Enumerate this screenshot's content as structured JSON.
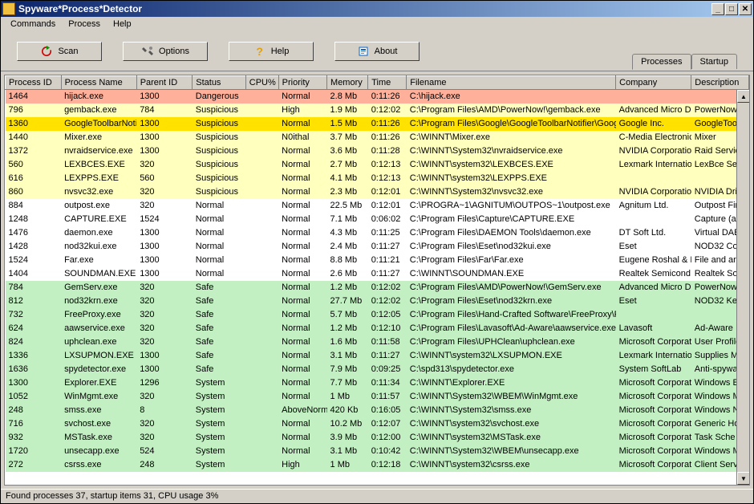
{
  "window": {
    "title": "Spyware*Process*Detector"
  },
  "menu": {
    "items": [
      "Commands",
      "Process",
      "Help"
    ]
  },
  "toolbar": {
    "scan": "Scan",
    "options": "Options",
    "help": "Help",
    "about": "About"
  },
  "tabs": {
    "items": [
      "Processes",
      "Startup"
    ],
    "active": 0
  },
  "table": {
    "columns": [
      "Process ID",
      "Process Name",
      "Parent ID",
      "Status",
      "CPU%",
      "Priority",
      "Memory",
      "Time",
      "Filename",
      "Company",
      "Description"
    ],
    "rows": [
      {
        "kind": "dangerous",
        "pid": "1464",
        "pname": "hijack.exe",
        "parent": "1300",
        "status": "Dangerous",
        "cpu": "",
        "prio": "Normal",
        "mem": "2.8 Mb",
        "time": "0:11:26",
        "file": "C:\\hijack.exe",
        "comp": "",
        "desc": ""
      },
      {
        "kind": "suspicious",
        "pid": "796",
        "pname": "gemback.exe",
        "parent": "784",
        "status": "Suspicious",
        "cpu": "",
        "prio": "High",
        "mem": "1.9 Mb",
        "time": "0:12:02",
        "file": "C:\\Program Files\\AMD\\PowerNow!\\gemback.exe",
        "comp": "Advanced Micro D",
        "desc": "PowerNow"
      },
      {
        "kind": "sel",
        "pid": "1360",
        "pname": "GoogleToolbarNotif",
        "parent": "1300",
        "status": "Suspicious",
        "cpu": "",
        "prio": "Normal",
        "mem": "1.5 Mb",
        "time": "0:11:26",
        "file": "C:\\Program Files\\Google\\GoogleToolbarNotifier\\Goog",
        "comp": "Google Inc.",
        "desc": "GoogleToo"
      },
      {
        "kind": "suspicious",
        "pid": "1440",
        "pname": "Mixer.exe",
        "parent": "1300",
        "status": "Suspicious",
        "cpu": "",
        "prio": "N0ithal",
        "mem": "3.7 Mb",
        "time": "0:11:26",
        "file": "C:\\WINNT\\Mixer.exe",
        "comp": "C-Media Electronic",
        "desc": "Mixer"
      },
      {
        "kind": "suspicious",
        "pid": "1372",
        "pname": "nvraidservice.exe",
        "parent": "1300",
        "status": "Suspicious",
        "cpu": "",
        "prio": "Normal",
        "mem": "3.6 Mb",
        "time": "0:11:28",
        "file": "C:\\WINNT\\System32\\nvraidservice.exe",
        "comp": "NVIDIA Corporation",
        "desc": "Raid Servic"
      },
      {
        "kind": "suspicious",
        "pid": "560",
        "pname": "LEXBCES.EXE",
        "parent": "320",
        "status": "Suspicious",
        "cpu": "",
        "prio": "Normal",
        "mem": "2.7 Mb",
        "time": "0:12:13",
        "file": "C:\\WINNT\\system32\\LEXBCES.EXE",
        "comp": "Lexmark Internation",
        "desc": "LexBce Ser"
      },
      {
        "kind": "suspicious",
        "pid": "616",
        "pname": "LEXPPS.EXE",
        "parent": "560",
        "status": "Suspicious",
        "cpu": "",
        "prio": "Normal",
        "mem": "4.1 Mb",
        "time": "0:12:13",
        "file": "C:\\WINNT\\system32\\LEXPPS.EXE",
        "comp": "",
        "desc": ""
      },
      {
        "kind": "suspicious",
        "pid": "860",
        "pname": "nvsvc32.exe",
        "parent": "320",
        "status": "Suspicious",
        "cpu": "",
        "prio": "Normal",
        "mem": "2.3 Mb",
        "time": "0:12:01",
        "file": "C:\\WINNT\\System32\\nvsvc32.exe",
        "comp": "NVIDIA Corporation",
        "desc": "NVIDIA Driv"
      },
      {
        "kind": "normal",
        "pid": "884",
        "pname": "outpost.exe",
        "parent": "320",
        "status": "Normal",
        "cpu": "",
        "prio": "Normal",
        "mem": "22.5 Mb",
        "time": "0:12:01",
        "file": "C:\\PROGRA~1\\AGNITUM\\OUTPOS~1\\outpost.exe",
        "comp": "Agnitum Ltd.",
        "desc": "Outpost Fire"
      },
      {
        "kind": "normal",
        "pid": "1248",
        "pname": "CAPTURE.EXE",
        "parent": "1524",
        "status": "Normal",
        "cpu": "",
        "prio": "Normal",
        "mem": "7.1 Mb",
        "time": "0:06:02",
        "file": "C:\\Program Files\\Capture\\CAPTURE.EXE",
        "comp": "",
        "desc": "Capture (a s"
      },
      {
        "kind": "normal",
        "pid": "1476",
        "pname": "daemon.exe",
        "parent": "1300",
        "status": "Normal",
        "cpu": "",
        "prio": "Normal",
        "mem": "4.3 Mb",
        "time": "0:11:25",
        "file": "C:\\Program Files\\DAEMON Tools\\daemon.exe",
        "comp": "DT Soft Ltd.",
        "desc": "Virtual DAE"
      },
      {
        "kind": "normal",
        "pid": "1428",
        "pname": "nod32kui.exe",
        "parent": "1300",
        "status": "Normal",
        "cpu": "",
        "prio": "Normal",
        "mem": "2.4 Mb",
        "time": "0:11:27",
        "file": "C:\\Program Files\\Eset\\nod32kui.exe",
        "comp": "Eset",
        "desc": "NOD32 Cor"
      },
      {
        "kind": "normal",
        "pid": "1524",
        "pname": "Far.exe",
        "parent": "1300",
        "status": "Normal",
        "cpu": "",
        "prio": "Normal",
        "mem": "8.8 Mb",
        "time": "0:11:21",
        "file": "C:\\Program Files\\Far\\Far.exe",
        "comp": "Eugene Roshal & F",
        "desc": "File and arc"
      },
      {
        "kind": "normal",
        "pid": "1404",
        "pname": "SOUNDMAN.EXE",
        "parent": "1300",
        "status": "Normal",
        "cpu": "",
        "prio": "Normal",
        "mem": "2.6 Mb",
        "time": "0:11:27",
        "file": "C:\\WINNT\\SOUNDMAN.EXE",
        "comp": "Realtek Semicond",
        "desc": "Realtek Sou"
      },
      {
        "kind": "safe",
        "pid": "784",
        "pname": "GemServ.exe",
        "parent": "320",
        "status": "Safe",
        "cpu": "",
        "prio": "Normal",
        "mem": "1.2 Mb",
        "time": "0:12:02",
        "file": "C:\\Program Files\\AMD\\PowerNow!\\GemServ.exe",
        "comp": "Advanced Micro D",
        "desc": "PowerNow!"
      },
      {
        "kind": "safe",
        "pid": "812",
        "pname": "nod32krn.exe",
        "parent": "320",
        "status": "Safe",
        "cpu": "",
        "prio": "Normal",
        "mem": "27.7 Mb",
        "time": "0:12:02",
        "file": "C:\\Program Files\\Eset\\nod32krn.exe",
        "comp": "Eset",
        "desc": "NOD32 Ker"
      },
      {
        "kind": "safe",
        "pid": "732",
        "pname": "FreeProxy.exe",
        "parent": "320",
        "status": "Safe",
        "cpu": "",
        "prio": "Normal",
        "mem": "5.7 Mb",
        "time": "0:12:05",
        "file": "C:\\Program Files\\Hand-Crafted Software\\FreeProxy\\F",
        "comp": "",
        "desc": ""
      },
      {
        "kind": "safe",
        "pid": "624",
        "pname": "aawservice.exe",
        "parent": "320",
        "status": "Safe",
        "cpu": "",
        "prio": "Normal",
        "mem": "1.2 Mb",
        "time": "0:12:10",
        "file": "C:\\Program Files\\Lavasoft\\Ad-Aware\\aawservice.exe",
        "comp": "Lavasoft",
        "desc": "Ad-Aware"
      },
      {
        "kind": "safe",
        "pid": "824",
        "pname": "uphclean.exe",
        "parent": "320",
        "status": "Safe",
        "cpu": "",
        "prio": "Normal",
        "mem": "1.6 Mb",
        "time": "0:11:58",
        "file": "C:\\Program Files\\UPHClean\\uphclean.exe",
        "comp": "Microsoft Corporati",
        "desc": "User Profile"
      },
      {
        "kind": "safe",
        "pid": "1336",
        "pname": "LXSUPMON.EXE",
        "parent": "1300",
        "status": "Safe",
        "cpu": "",
        "prio": "Normal",
        "mem": "3.1 Mb",
        "time": "0:11:27",
        "file": "C:\\WINNT\\system32\\LXSUPMON.EXE",
        "comp": "Lexmark Internation",
        "desc": "Supplies Mo"
      },
      {
        "kind": "safe",
        "pid": "1636",
        "pname": "spydetector.exe",
        "parent": "1300",
        "status": "Safe",
        "cpu": "",
        "prio": "Normal",
        "mem": "7.9 Mb",
        "time": "0:09:25",
        "file": "C:\\spd313\\spydetector.exe",
        "comp": "System SoftLab",
        "desc": "Anti-spywar"
      },
      {
        "kind": "system",
        "pid": "1300",
        "pname": "Explorer.EXE",
        "parent": "1296",
        "status": "System",
        "cpu": "",
        "prio": "Normal",
        "mem": "7.7 Mb",
        "time": "0:11:34",
        "file": "C:\\WINNT\\Explorer.EXE",
        "comp": "Microsoft Corporati",
        "desc": "Windows E"
      },
      {
        "kind": "system",
        "pid": "1052",
        "pname": "WinMgmt.exe",
        "parent": "320",
        "status": "System",
        "cpu": "",
        "prio": "Normal",
        "mem": "1 Mb",
        "time": "0:11:57",
        "file": "C:\\WINNT\\System32\\WBEM\\WinMgmt.exe",
        "comp": "Microsoft Corporati",
        "desc": "Windows M"
      },
      {
        "kind": "system",
        "pid": "248",
        "pname": "smss.exe",
        "parent": "8",
        "status": "System",
        "cpu": "",
        "prio": "AboveNorm",
        "mem": "420 Kb",
        "time": "0:16:05",
        "file": "C:\\WINNT\\System32\\smss.exe",
        "comp": "Microsoft Corporati",
        "desc": "Windows N"
      },
      {
        "kind": "system",
        "pid": "716",
        "pname": "svchost.exe",
        "parent": "320",
        "status": "System",
        "cpu": "",
        "prio": "Normal",
        "mem": "10.2 Mb",
        "time": "0:12:07",
        "file": "C:\\WINNT\\system32\\svchost.exe",
        "comp": "Microsoft Corporati",
        "desc": "Generic Ho"
      },
      {
        "kind": "system",
        "pid": "932",
        "pname": "MSTask.exe",
        "parent": "320",
        "status": "System",
        "cpu": "",
        "prio": "Normal",
        "mem": "3.9 Mb",
        "time": "0:12:00",
        "file": "C:\\WINNT\\system32\\MSTask.exe",
        "comp": "Microsoft Corporati",
        "desc": "Task Sche"
      },
      {
        "kind": "system",
        "pid": "1720",
        "pname": "unsecapp.exe",
        "parent": "524",
        "status": "System",
        "cpu": "",
        "prio": "Normal",
        "mem": "3.1 Mb",
        "time": "0:10:42",
        "file": "C:\\WINNT\\System32\\WBEM\\unsecapp.exe",
        "comp": "Microsoft Corporati",
        "desc": "Windows M"
      },
      {
        "kind": "system",
        "pid": "272",
        "pname": "csrss.exe",
        "parent": "248",
        "status": "System",
        "cpu": "",
        "prio": "High",
        "mem": "1 Mb",
        "time": "0:12:18",
        "file": "C:\\WINNT\\system32\\csrss.exe",
        "comp": "Microsoft Corporati",
        "desc": "Client Serve"
      }
    ]
  },
  "status": {
    "text": "Found processes 37,  startup items 31, CPU usage 3%"
  }
}
